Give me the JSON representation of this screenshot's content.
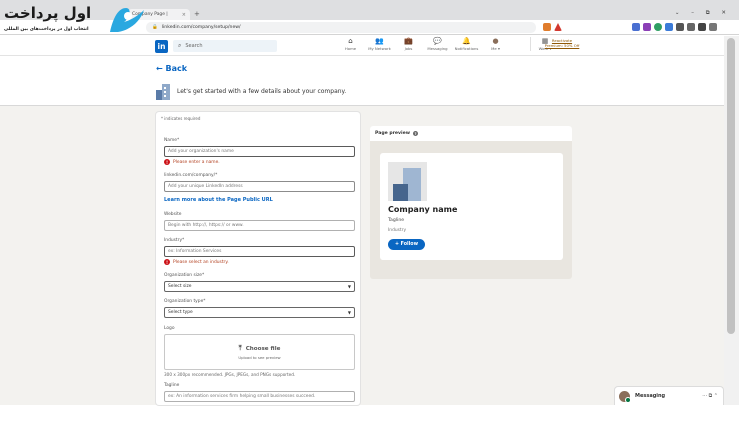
{
  "browser": {
    "tab_title": "Company Page |",
    "url": "linkedin.com/company/setup/new/",
    "window_controls": "⌄ – ⧉ ✕"
  },
  "brand": {
    "title": "اول پرداخت",
    "subtitle": "انتخاب اول در پرداخت‌های بین المللی"
  },
  "header": {
    "logo": "in",
    "search_placeholder": "Search",
    "nav": [
      {
        "label": "Home",
        "icon": "home-icon",
        "glyph": "⌂"
      },
      {
        "label": "My Network",
        "icon": "network-icon",
        "glyph": "👥"
      },
      {
        "label": "Jobs",
        "icon": "jobs-icon",
        "glyph": "💼"
      },
      {
        "label": "Messaging",
        "icon": "messaging-icon",
        "glyph": "💬"
      },
      {
        "label": "Notifications",
        "icon": "bell-icon",
        "glyph": "🔔"
      },
      {
        "label": "Me ▾",
        "icon": "avatar-icon",
        "glyph": "●"
      },
      {
        "label": "Work ▾",
        "icon": "grid-icon",
        "glyph": "▦"
      }
    ],
    "premium": "Reactivate Premium: 50% Off"
  },
  "hero": {
    "back": "Back",
    "text": "Let's get started with a few details about your company."
  },
  "form": {
    "required_note": "* indicates required",
    "name_label": "Name*",
    "name_placeholder": "Add your organization's name",
    "name_error": "Please enter a name.",
    "url_label": "linkedin.com/company/*",
    "url_placeholder": "Add your unique LinkedIn address",
    "learn_more": "Learn more about the Page Public URL",
    "website_label": "Website",
    "website_placeholder": "Begin with http://, https:// or www.",
    "industry_label": "Industry*",
    "industry_placeholder": "ex: Information Services",
    "industry_error": "Please select an industry.",
    "size_label": "Organization size*",
    "size_value": "Select size",
    "type_label": "Organization type*",
    "type_value": "Select type",
    "logo_label": "Logo",
    "choose_file": "Choose file",
    "upload_hint": "Upload to see preview",
    "logo_hint": "300 x 300px recommended. JPGs, JPEGs, and PNGs supported.",
    "tagline_label": "Tagline",
    "tagline_placeholder": "ex: An information services firm helping small businesses succeed."
  },
  "preview": {
    "heading": "Page preview",
    "company_name": "Company name",
    "tagline": "Tagline",
    "industry": "Industry",
    "follow": "+ Follow"
  },
  "messaging": {
    "label": "Messaging",
    "icons": "··· ⧉ ⌃"
  },
  "colors": {
    "brand_blue": "#0a66c2",
    "error_red": "#cc1016",
    "page_bg": "#f3f2ef"
  }
}
